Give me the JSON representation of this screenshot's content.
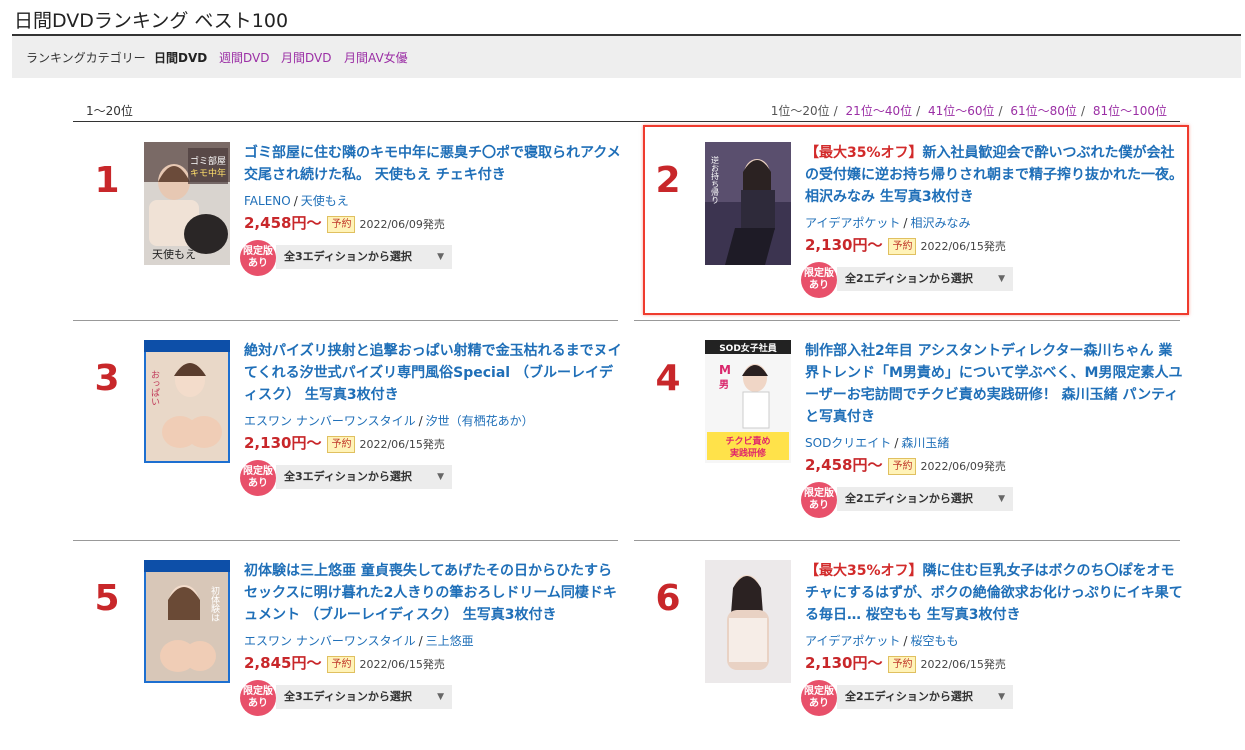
{
  "header": {
    "title": "日間DVDランキング ベスト100"
  },
  "categories": {
    "label": "ランキングカテゴリー",
    "items": [
      {
        "label": "日間DVD",
        "active": true
      },
      {
        "label": "週間DVD",
        "active": false
      },
      {
        "label": "月間DVD",
        "active": false
      },
      {
        "label": "月間AV女優",
        "active": false
      }
    ]
  },
  "range_label": "1〜20位",
  "pager": [
    "1位〜20位",
    "21位〜40位",
    "41位〜60位",
    "61位〜80位",
    "81位〜100位"
  ],
  "colors": {
    "rank": "#c8272a",
    "title_link": "#1f6fb8",
    "category_link": "#9b2fa5",
    "limited_badge": "#e8506a",
    "highlight": "#ef3b2d"
  },
  "items": [
    {
      "rank": "1",
      "promo": "",
      "title": "ゴミ部屋に住む隣のキモ中年に悪臭チ〇ポで寝取られアクメ交尾され続けた私。 天使もえ チェキ付き",
      "maker": "FALENO",
      "actress": "天使もえ",
      "price": "2,458円〜",
      "badge": "予約",
      "date": "2022/06/09発売",
      "limited": "限定版あり",
      "editions": "全3エディションから選択",
      "thumb_text": "天使もえ"
    },
    {
      "rank": "2",
      "promo": "【最大35%オフ】",
      "title": "新入社員歓迎会で酔いつぶれた僕が会社の受付嬢に逆お持ち帰りされ朝まで精子搾り抜かれた一夜。 相沢みなみ 生写真3枚付き",
      "maker": "アイデアポケット",
      "actress": "相沢みなみ",
      "price": "2,130円〜",
      "badge": "予約",
      "date": "2022/06/15発売",
      "limited": "限定版あり",
      "editions": "全2エディションから選択",
      "thumb_text": "逆お持ち帰り"
    },
    {
      "rank": "3",
      "promo": "",
      "title": "絶対パイズリ挟射と追撃おっぱい射精で金玉枯れるまでヌイてくれる汐世式パイズリ専門風俗Special （ブルーレイディスク） 生写真3枚付き",
      "maker": "エスワン ナンバーワンスタイル",
      "actress": "汐世（有栖花あか）",
      "price": "2,130円〜",
      "badge": "予約",
      "date": "2022/06/15発売",
      "limited": "限定版あり",
      "editions": "全3エディションから選択",
      "thumb_text": "おっぱい"
    },
    {
      "rank": "4",
      "promo": "",
      "title": "制作部入社2年目 アシスタントディレクター森川ちゃん 業界トレンド「M男責め」について学ぶべく、M男限定素人ユーザーお宅訪問でチクビ責め実践研修！ 森川玉緒 パンティと写真付き",
      "maker": "SODクリエイト",
      "actress": "森川玉緒",
      "price": "2,458円〜",
      "badge": "予約",
      "date": "2022/06/09発売",
      "limited": "限定版あり",
      "editions": "全2エディションから選択",
      "thumb_text": "SOD女子社員"
    },
    {
      "rank": "5",
      "promo": "",
      "title": "初体験は三上悠亜 童貞喪失してあげたその日からひたすらセックスに明け暮れた2人きりの筆おろしドリーム同棲ドキュメント （ブルーレイディスク） 生写真3枚付き",
      "maker": "エスワン ナンバーワンスタイル",
      "actress": "三上悠亜",
      "price": "2,845円〜",
      "badge": "予約",
      "date": "2022/06/15発売",
      "limited": "限定版あり",
      "editions": "全3エディションから選択",
      "thumb_text": "初体験は"
    },
    {
      "rank": "6",
      "promo": "【最大35%オフ】",
      "title": "隣に住む巨乳女子はボクのち〇ぽをオモチャにするはずが、ボクの絶倫欲求お化けっぷりにイキ果てる毎日… 桜空もも 生写真3枚付き",
      "maker": "アイデアポケット",
      "actress": "桜空もも",
      "price": "2,130円〜",
      "badge": "予約",
      "date": "2022/06/15発売",
      "limited": "限定版あり",
      "editions": "全2エディションから選択",
      "thumb_text": ""
    }
  ]
}
